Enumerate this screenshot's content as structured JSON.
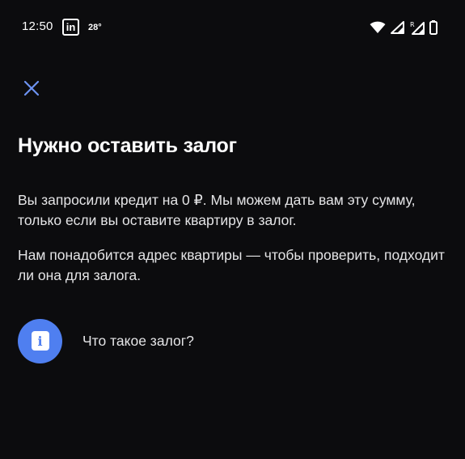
{
  "status_bar": {
    "time": "12:50",
    "app_badge": "in",
    "temperature": "28°",
    "icons": [
      "wifi-icon",
      "signal-icon",
      "signal-roaming-icon",
      "battery-icon"
    ]
  },
  "header": {
    "close_icon": "close-icon"
  },
  "main": {
    "title": "Нужно оставить залог",
    "paragraph1": "Вы запросили кредит на 0 ₽. Мы можем дать вам эту сумму, только если вы оставите квартиру в залог.",
    "paragraph2": "Нам понадобится адрес квартиры — чтобы проверить, подходит ли она для залога.",
    "info_link": {
      "icon": "info-icon",
      "glyph": "i",
      "label": "Что такое залог?"
    }
  },
  "colors": {
    "background": "#0c0c0e",
    "accent": "#4f7ff0",
    "close_icon": "#6d93f2",
    "text": "#e4e4e6"
  }
}
